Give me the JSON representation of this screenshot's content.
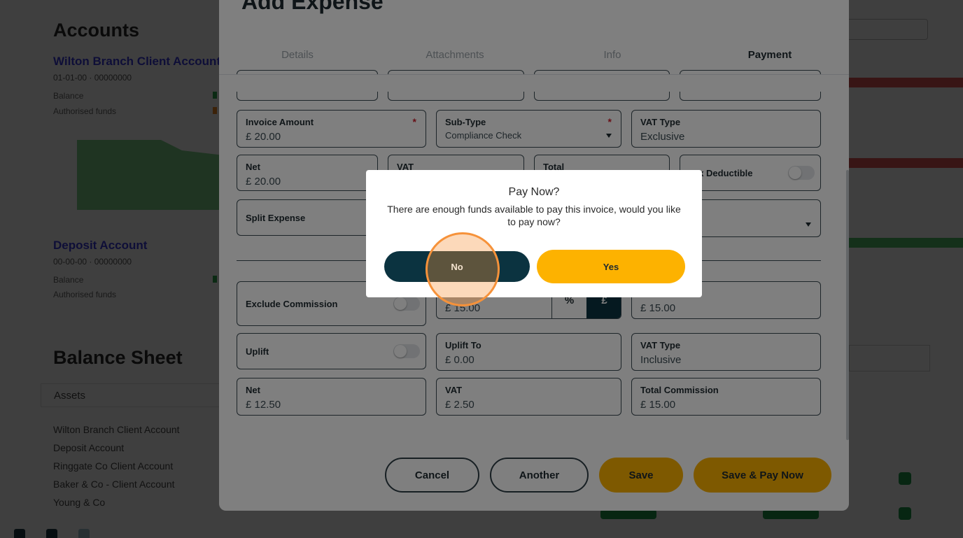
{
  "background": {
    "title": "Accounts",
    "accounts": [
      {
        "name": "Wilton Branch Client Account",
        "sub": "01-01-00 · 00000000",
        "lines": [
          "Balance",
          "Authorised funds"
        ]
      },
      {
        "name": "Deposit Account",
        "sub": "00-00-00 · 00000000",
        "lines": [
          "Balance",
          "Authorised funds"
        ]
      }
    ],
    "balance_sheet": {
      "title": "Balance Sheet",
      "assets_label": "Assets",
      "rows": [
        "Wilton Branch Client Account",
        "Deposit Account",
        "Ringgate Co Client Account",
        "Baker & Co - Client Account",
        "Young & Co"
      ]
    }
  },
  "modal": {
    "title": "Add Expense",
    "tabs": [
      {
        "label": "Details",
        "active": false
      },
      {
        "label": "Attachments",
        "active": false
      },
      {
        "label": "Info",
        "active": false
      },
      {
        "label": "Payment",
        "active": true
      }
    ],
    "fields": {
      "invoice_amount": {
        "label": "Invoice Amount",
        "value": "£ 20.00",
        "required": "*"
      },
      "sub_type": {
        "label": "Sub-Type",
        "value": "Compliance Check",
        "required": "*"
      },
      "vat_type": {
        "label": "VAT Type",
        "value": "Exclusive"
      },
      "net": {
        "label": "Net",
        "value": "£ 20.00"
      },
      "vat": {
        "label": "VAT"
      },
      "total": {
        "label": "Total"
      },
      "tax_deductible": {
        "label": "Tax Deductible"
      },
      "split_expense": {
        "label": "Split Expense"
      },
      "exclude_commission": {
        "label": "Exclude Commission"
      },
      "commission_amount": {
        "value": "£ 15.00",
        "pct": "%",
        "gbp": "£"
      },
      "commission_total": {
        "value": "£ 15.00"
      },
      "uplift": {
        "label": "Uplift"
      },
      "uplift_to": {
        "label": "Uplift To",
        "value": "£ 0.00"
      },
      "uplift_vat_type": {
        "label": "VAT Type",
        "value": "Inclusive"
      },
      "comm_net": {
        "label": "Net",
        "value": "£ 12.50"
      },
      "comm_vat": {
        "label": "VAT",
        "value": "£ 2.50"
      },
      "total_commission": {
        "label": "Total Commission",
        "value": "£ 15.00"
      }
    },
    "buttons": {
      "cancel": "Cancel",
      "another": "Another",
      "save": "Save",
      "save_pay": "Save & Pay Now"
    }
  },
  "dialog": {
    "title": "Pay Now?",
    "message": "There are enough funds available to pay this invoice, would you like to pay now?",
    "no": "No",
    "yes": "Yes"
  },
  "colors": {
    "accent_yellow": "#fdb200",
    "dark_teal": "#0b3340",
    "required_red": "#d0202e",
    "click_ring": "#f6923a"
  }
}
